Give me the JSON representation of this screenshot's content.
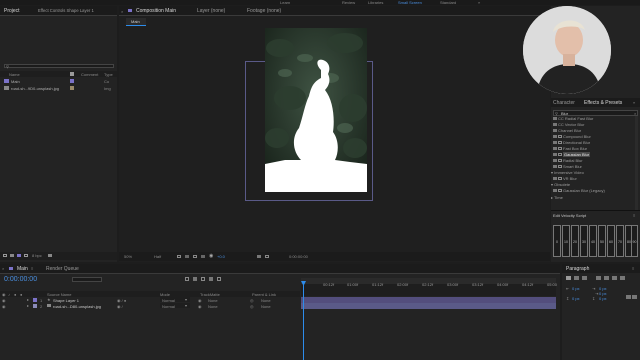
{
  "menubar": {
    "items": [
      "Learn",
      "Review",
      "Libraries",
      "Small Screen",
      "Standard"
    ],
    "overflow": "»"
  },
  "project_panel": {
    "tab": "Project",
    "effect_controls_tab": "Effect Controls Shape Layer 1",
    "columns": {
      "name": "Name",
      "comment": "Comment",
      "type": "Type"
    },
    "items": [
      {
        "name": "Main",
        "type": "Co"
      },
      {
        "name": "road-sh...9D0-unsplash.jpg",
        "type": "Img"
      }
    ],
    "bpc": "8 bpc"
  },
  "composition_panel": {
    "tabs": {
      "composition": "Composition Main",
      "layer": "Layer (none)",
      "footage": "Footage (none)"
    },
    "breadcrumb": "Main",
    "zoom": "50%",
    "resolution": "Half",
    "exposure": "+0.0",
    "timecode": "0:00:00:00"
  },
  "right_panel": {
    "tabs": [
      "Character",
      "Effects & Presets"
    ],
    "search_value": "Blur",
    "effects": [
      {
        "label": "CC Radial Fast Blur",
        "kind": "effect"
      },
      {
        "label": "CC Vector Blur",
        "kind": "effect"
      },
      {
        "label": "Channel Blur",
        "kind": "effect"
      },
      {
        "label": "Compound Blur",
        "kind": "effect"
      },
      {
        "label": "Directional Blur",
        "kind": "effect"
      },
      {
        "label": "Fast Box Blur",
        "kind": "effect"
      },
      {
        "label": "Gaussian Blur",
        "kind": "effect",
        "selected": true
      },
      {
        "label": "Radial Blur",
        "kind": "effect"
      },
      {
        "label": "Smart Blur",
        "kind": "effect"
      },
      {
        "label": "Immersive Video",
        "kind": "group"
      },
      {
        "label": "VR Blur",
        "kind": "effect"
      },
      {
        "label": "Obsolete",
        "kind": "group"
      },
      {
        "label": "Gaussian Blur (Legacy)",
        "kind": "effect"
      },
      {
        "label": "Time",
        "kind": "group"
      }
    ],
    "script_title": "Edit Velocity Script",
    "slider_values": [
      "0",
      "10",
      "20",
      "30",
      "40",
      "50",
      "60",
      "70",
      "80",
      "90",
      "100"
    ]
  },
  "timeline": {
    "comp_tab": "Main",
    "render_queue_tab": "Render Queue",
    "timecode": "0:00:00:00",
    "columns": {
      "source_name": "Source Name",
      "mode": "Mode",
      "trackmatte": "TrackMatte",
      "parent": "Parent & Link"
    },
    "layers": [
      {
        "num": "1",
        "name": "Shape Layer 1",
        "mode": "Normal",
        "matte": "None",
        "parent": "None"
      },
      {
        "num": "2",
        "name": "road-sh...D80-unsplash.jpg",
        "mode": "Normal",
        "matte": "None",
        "parent": "None"
      }
    ],
    "ruler": [
      "00:12f",
      "01:00f",
      "01:12f",
      "02:00f",
      "02:12f",
      "03:00f",
      "03:12f",
      "04:00f",
      "04:12f",
      "05:00"
    ]
  },
  "paragraph_panel": {
    "title": "Paragraph",
    "fields": [
      "0 px",
      "0 px",
      "0 px",
      "0 px",
      "0 px"
    ]
  },
  "colors": {
    "accent": "#2d8ceb",
    "label_purple": "#7b72c8",
    "bar_green": "#3d6b4b",
    "bar_purple": "#5a5a88"
  }
}
